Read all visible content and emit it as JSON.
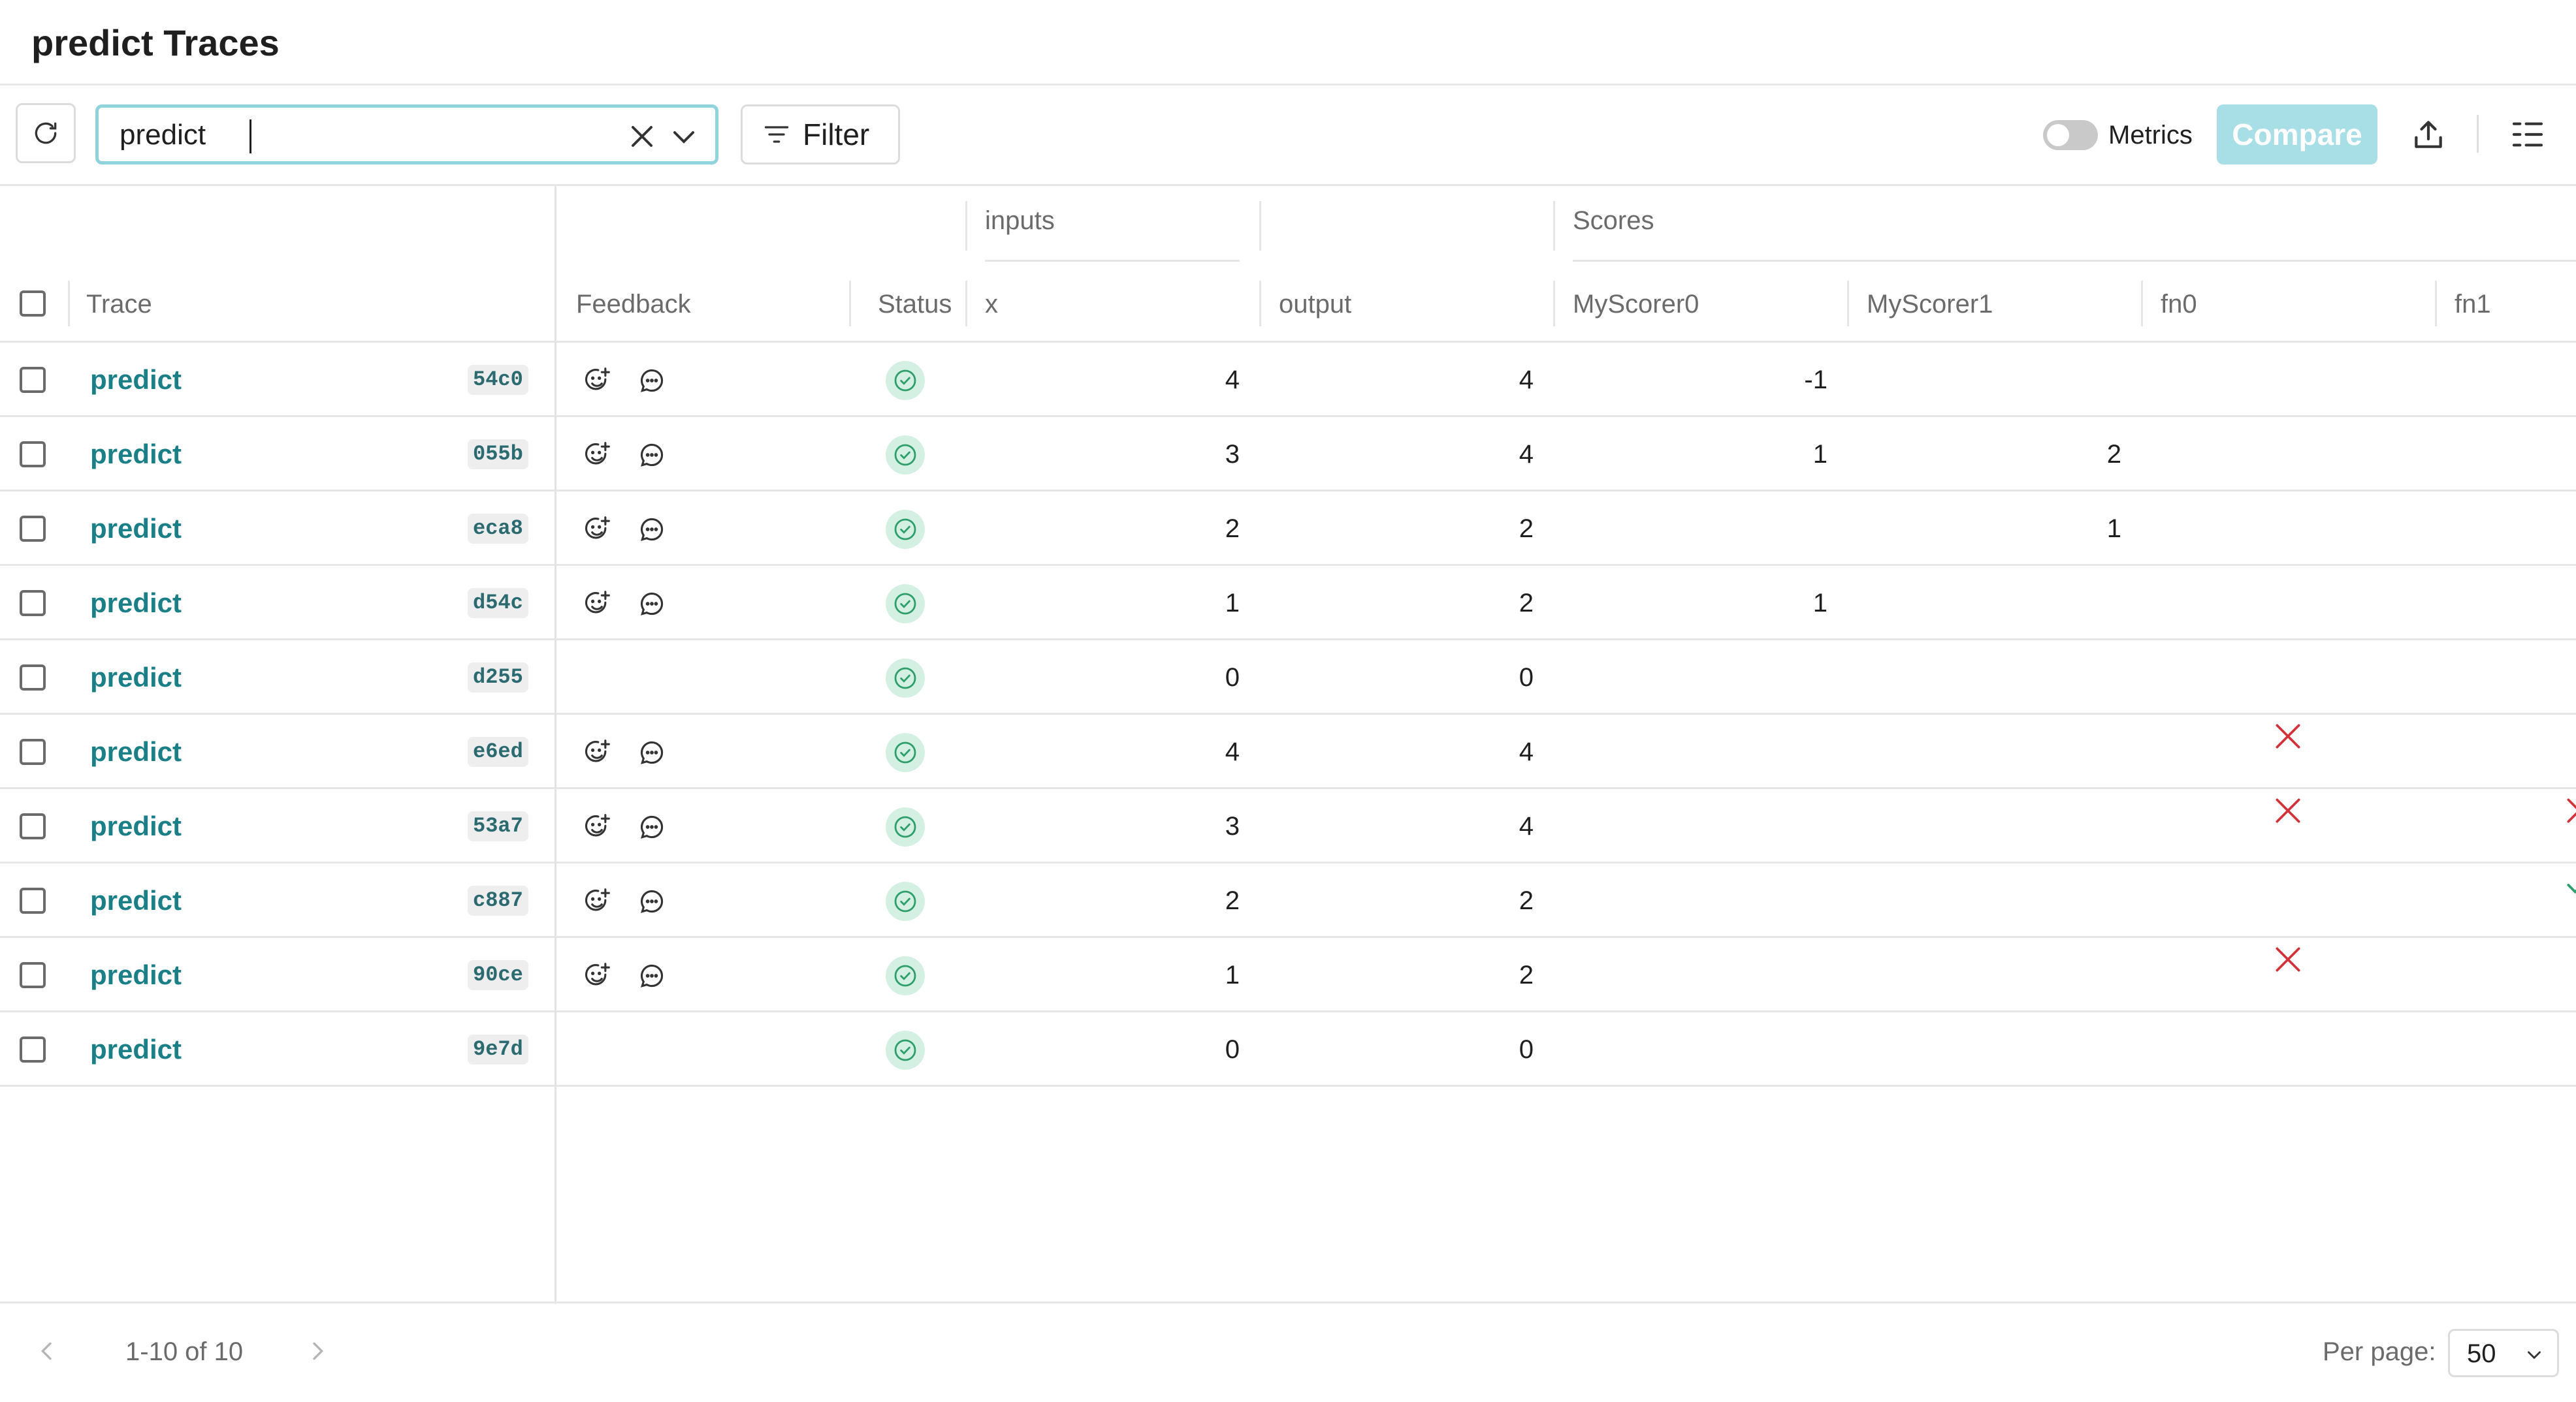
{
  "page": {
    "title": "predict Traces"
  },
  "toolbar": {
    "search_value": "predict",
    "filter_label": "Filter",
    "metrics_label": "Metrics",
    "metrics_on": false,
    "compare_label": "Compare"
  },
  "table": {
    "group_headers": {
      "inputs": "inputs",
      "scores": "Scores"
    },
    "columns": {
      "trace": "Trace",
      "feedback": "Feedback",
      "status": "Status",
      "x": "x",
      "output": "output",
      "myscorer0": "MyScorer0",
      "myscorer1": "MyScorer1",
      "fn0": "fn0",
      "fn1": "fn1"
    },
    "rows": [
      {
        "name": "predict",
        "id": "54c0",
        "feedback": true,
        "status": "success",
        "x": "4",
        "output": "4",
        "myscorer0": "-1",
        "myscorer1": "",
        "fn0": "",
        "fn1": ""
      },
      {
        "name": "predict",
        "id": "055b",
        "feedback": true,
        "status": "success",
        "x": "3",
        "output": "4",
        "myscorer0": "1",
        "myscorer1": "2",
        "fn0": "",
        "fn1": ""
      },
      {
        "name": "predict",
        "id": "eca8",
        "feedback": true,
        "status": "success",
        "x": "2",
        "output": "2",
        "myscorer0": "",
        "myscorer1": "1",
        "fn0": "",
        "fn1": ""
      },
      {
        "name": "predict",
        "id": "d54c",
        "feedback": true,
        "status": "success",
        "x": "1",
        "output": "2",
        "myscorer0": "1",
        "myscorer1": "",
        "fn0": "",
        "fn1": ""
      },
      {
        "name": "predict",
        "id": "d255",
        "feedback": false,
        "status": "success",
        "x": "0",
        "output": "0",
        "myscorer0": "",
        "myscorer1": "",
        "fn0": "",
        "fn1": ""
      },
      {
        "name": "predict",
        "id": "e6ed",
        "feedback": true,
        "status": "success",
        "x": "4",
        "output": "4",
        "myscorer0": "",
        "myscorer1": "",
        "fn0": "false",
        "fn1": ""
      },
      {
        "name": "predict",
        "id": "53a7",
        "feedback": true,
        "status": "success",
        "x": "3",
        "output": "4",
        "myscorer0": "",
        "myscorer1": "",
        "fn0": "false",
        "fn1": "false"
      },
      {
        "name": "predict",
        "id": "c887",
        "feedback": true,
        "status": "success",
        "x": "2",
        "output": "2",
        "myscorer0": "",
        "myscorer1": "",
        "fn0": "",
        "fn1": "true"
      },
      {
        "name": "predict",
        "id": "90ce",
        "feedback": true,
        "status": "success",
        "x": "1",
        "output": "2",
        "myscorer0": "",
        "myscorer1": "",
        "fn0": "false",
        "fn1": ""
      },
      {
        "name": "predict",
        "id": "9e7d",
        "feedback": false,
        "status": "success",
        "x": "0",
        "output": "0",
        "myscorer0": "",
        "myscorer1": "",
        "fn0": "",
        "fn1": ""
      }
    ]
  },
  "pagination": {
    "range": "1-10 of 10",
    "per_page_label": "Per page:",
    "per_page_value": "50"
  },
  "colors": {
    "accent": "#1a7f86",
    "success": "#2e9e6a",
    "error": "#d1333b",
    "compare_disabled": "#a8dfe6"
  },
  "icons": {
    "refresh": "refresh-icon",
    "clear": "close-icon",
    "dropdown": "chevron-down-icon",
    "filter": "filter-lines-icon",
    "export": "export-icon",
    "columns": "columns-icon",
    "feedback_emoji": "add-reaction-icon",
    "feedback_comment": "comment-icon",
    "status": "check-circle-icon",
    "score_false": "x-mark-icon",
    "score_true": "check-mark-icon"
  }
}
